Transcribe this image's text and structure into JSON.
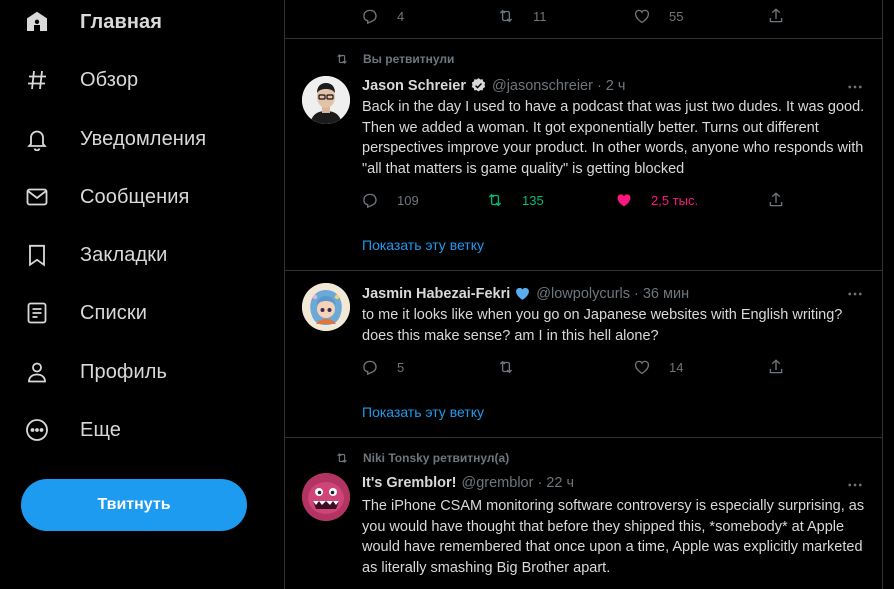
{
  "sidebar": {
    "items": [
      {
        "label": "Главная",
        "icon": "home-icon"
      },
      {
        "label": "Обзор",
        "icon": "hashtag-icon"
      },
      {
        "label": "Уведомления",
        "icon": "bell-icon"
      },
      {
        "label": "Сообщения",
        "icon": "mail-icon"
      },
      {
        "label": "Закладки",
        "icon": "bookmark-icon"
      },
      {
        "label": "Списки",
        "icon": "list-icon"
      },
      {
        "label": "Профиль",
        "icon": "person-icon"
      },
      {
        "label": "Еще",
        "icon": "more-circle-icon"
      }
    ],
    "tweet_button": "Твитнуть"
  },
  "feed": {
    "top_actions": {
      "replies": "4",
      "retweets": "11",
      "likes": "55"
    },
    "tweets": [
      {
        "retweet_label": "Вы ретвитнули",
        "name": "Jason Schreier",
        "verified": true,
        "handle": "@jasonschreier",
        "dot": "·",
        "time": "2 ч",
        "text": "Back in the day I used to have a podcast that was just two dudes. It was good. Then we added a woman. It got exponentially better. Turns out different perspectives improve your product. In other words, anyone who responds with \"all that matters is game quality\" is getting blocked",
        "replies": "109",
        "retweets": "135",
        "likes": "2,5 тыс.",
        "thread_link": "Показать эту ветку"
      },
      {
        "name": "Jasmin Habezai-Fekri",
        "emoji_heart": "blue-heart-icon",
        "handle": "@lowpolycurls",
        "dot": "·",
        "time": "36 мин",
        "text": "to me it looks like when you go on Japanese websites with English writing? does this make sense? am I in this hell alone?",
        "replies": "5",
        "retweets": "",
        "likes": "14",
        "thread_link": "Показать эту ветку"
      },
      {
        "retweet_label": "Niki Tonsky ретвитнул(а)",
        "name": "It's Gremblor!",
        "handle": "@gremblor",
        "dot": "·",
        "time": "22 ч",
        "text": "The iPhone CSAM monitoring software controversy is especially surprising, as you would have thought that before they shipped this, *somebody* at Apple would have remembered that once upon a time, Apple was explicitly marketed as literally smashing Big Brother apart."
      }
    ]
  },
  "colors": {
    "accent": "#1d9bf0",
    "retweet_green": "#00ba7c",
    "like_pink": "#f91880",
    "muted": "#6e767d"
  }
}
